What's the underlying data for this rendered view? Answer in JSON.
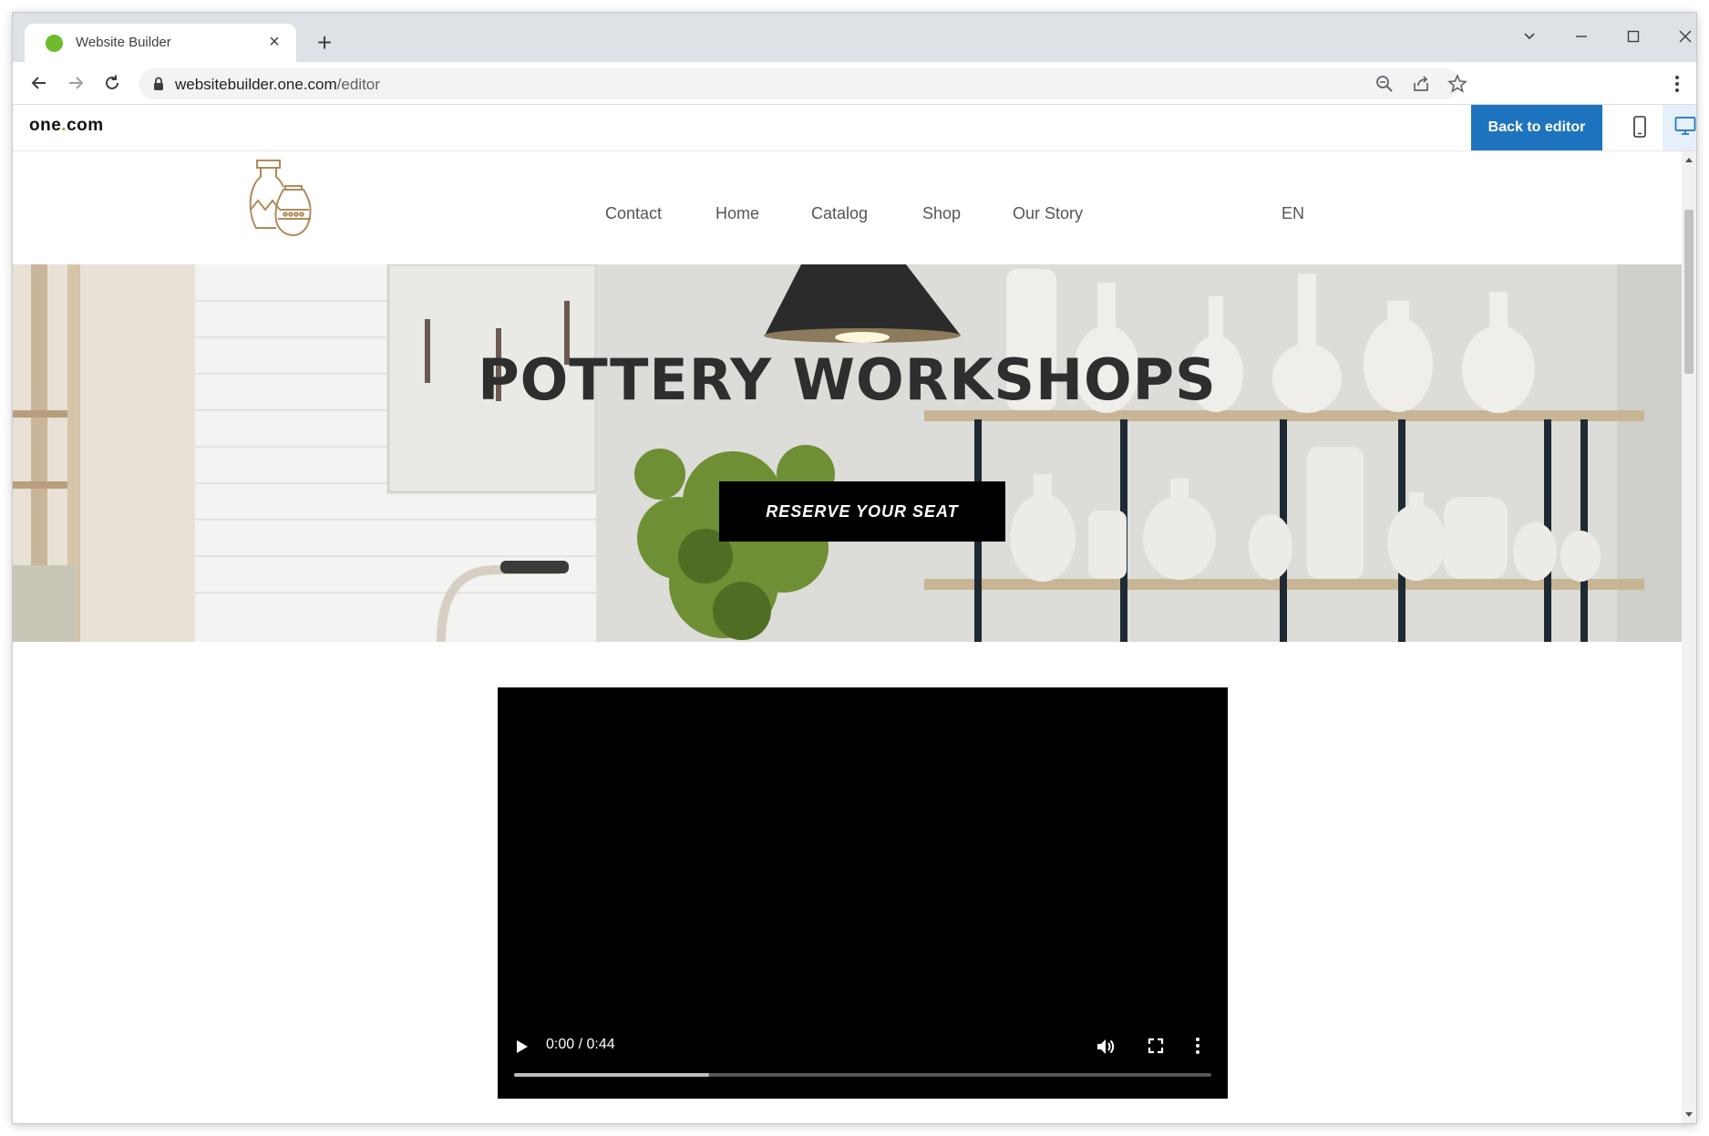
{
  "browser": {
    "tab_title": "Website Builder",
    "url_host": "websitebuilder.one.com",
    "url_path": "/editor"
  },
  "editor": {
    "brand_prefix": "one",
    "brand_dot": ".",
    "brand_suffix": "com",
    "back_to_editor_label": "Back to editor",
    "accent_color": "#1e73be"
  },
  "site": {
    "nav": [
      {
        "label": "Contact"
      },
      {
        "label": "Home"
      },
      {
        "label": "Catalog"
      },
      {
        "label": "Shop"
      },
      {
        "label": "Our Story"
      }
    ],
    "language": "EN",
    "hero": {
      "title": "POTTERY WORKSHOPS",
      "button_label": "RESERVE YOUR SEAT"
    },
    "video": {
      "time": "0:00 / 0:44",
      "progress_fraction": 0.28
    }
  }
}
